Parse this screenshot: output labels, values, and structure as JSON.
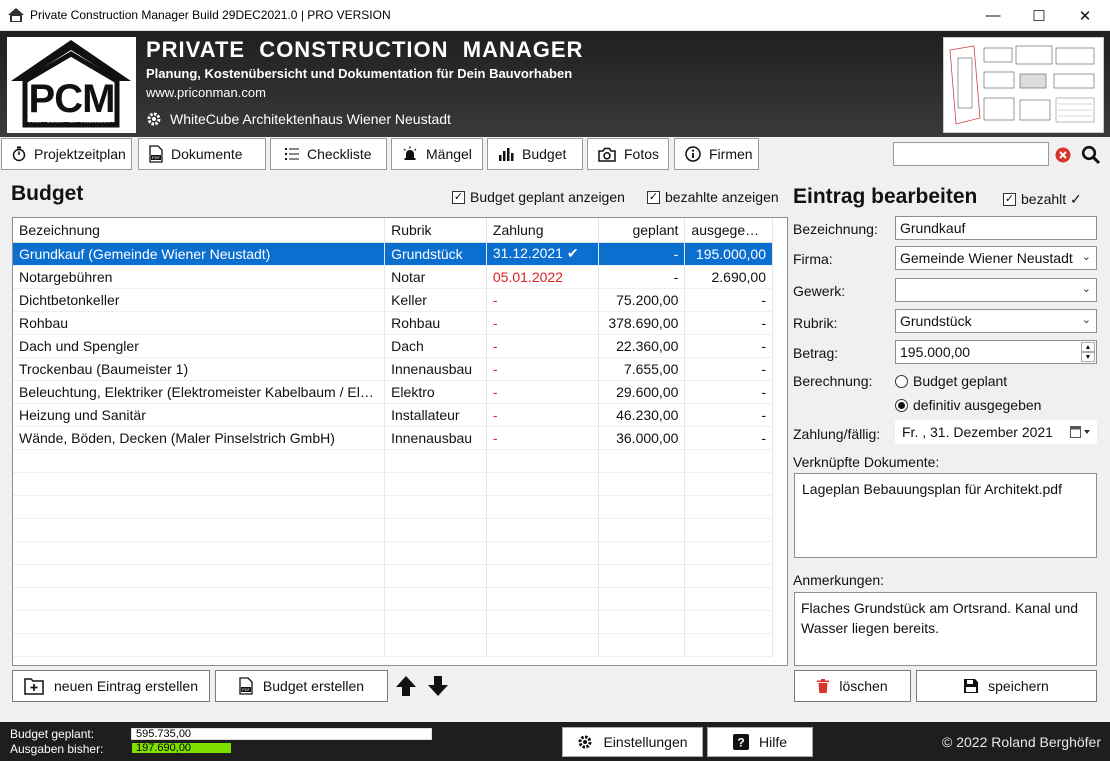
{
  "window": {
    "title": "Private Construction Manager Build 29DEC2021.0 | PRO VERSION",
    "minimize": "—",
    "maximize": "☐",
    "close": "✕"
  },
  "header": {
    "logo_text": "PCM",
    "logo_subtext": "PRIVATE CONSTRUCTION MANAGER",
    "title": "PRIVATE  CONSTRUCTION  MANAGER",
    "subtitle": "Planung, Kostenübersicht und Dokumentation für Dein Bauvorhaben",
    "website": "www.priconman.com",
    "project": "WhiteCube Architektenhaus Wiener Neustadt"
  },
  "toolbar": {
    "buttons": [
      {
        "label": "Projektzeitplan",
        "icon": "stopwatch-icon"
      },
      {
        "label": "Dokumente",
        "icon": "pdf-icon"
      },
      {
        "label": "Checkliste",
        "icon": "list-icon"
      },
      {
        "label": "Mängel",
        "icon": "alarm-icon"
      },
      {
        "label": "Budget",
        "icon": "bar-chart-icon"
      },
      {
        "label": "Fotos",
        "icon": "camera-icon"
      },
      {
        "label": "Firmen",
        "icon": "info-icon"
      }
    ],
    "search_value": ""
  },
  "budget": {
    "title": "Budget",
    "show_planned_label": "Budget geplant anzeigen",
    "show_planned": true,
    "show_paid_label": "bezahlte anzeigen",
    "show_paid": true,
    "columns": [
      "Bezeichnung",
      "Rubrik",
      "Zahlung",
      "geplant",
      "ausgegeben"
    ],
    "rows": [
      {
        "bezeichnung": "Grundkauf (Gemeinde Wiener Neustadt)",
        "rubrik": "Grundstück",
        "zahlung": "31.12.2021",
        "paid": true,
        "geplant": "-",
        "ausgegeben": "195.000,00",
        "selected": true
      },
      {
        "bezeichnung": "Notargebühren",
        "rubrik": "Notar",
        "zahlung": "05.01.2022",
        "paid": false,
        "geplant": "-",
        "ausgegeben": "2.690,00",
        "selected": false
      },
      {
        "bezeichnung": "Dichtbetonkeller",
        "rubrik": "Keller",
        "zahlung": "-",
        "paid": false,
        "geplant": "75.200,00",
        "ausgegeben": "-",
        "selected": false
      },
      {
        "bezeichnung": "Rohbau",
        "rubrik": "Rohbau",
        "zahlung": "-",
        "paid": false,
        "geplant": "378.690,00",
        "ausgegeben": "-",
        "selected": false
      },
      {
        "bezeichnung": "Dach und Spengler",
        "rubrik": "Dach",
        "zahlung": "-",
        "paid": false,
        "geplant": "22.360,00",
        "ausgegeben": "-",
        "selected": false
      },
      {
        "bezeichnung": "Trockenbau (Baumeister 1)",
        "rubrik": "Innenausbau",
        "zahlung": "-",
        "paid": false,
        "geplant": "7.655,00",
        "ausgegeben": "-",
        "selected": false
      },
      {
        "bezeichnung": "Beleuchtung, Elektriker (Elektromeister Kabelbaum / Ele...",
        "rubrik": "Elektro",
        "zahlung": "-",
        "paid": false,
        "geplant": "29.600,00",
        "ausgegeben": "-",
        "selected": false
      },
      {
        "bezeichnung": "Heizung und Sanitär",
        "rubrik": "Installateur",
        "zahlung": "-",
        "paid": false,
        "geplant": "46.230,00",
        "ausgegeben": "-",
        "selected": false
      },
      {
        "bezeichnung": "Wände, Böden, Decken (Maler Pinselstrich GmbH)",
        "rubrik": "Innenausbau",
        "zahlung": "-",
        "paid": false,
        "geplant": "36.000,00",
        "ausgegeben": "-",
        "selected": false
      }
    ],
    "new_entry_label": "neuen Eintrag erstellen",
    "create_budget_label": "Budget erstellen"
  },
  "edit": {
    "title": "Eintrag bearbeiten",
    "paid_label": "bezahlt ✓",
    "paid": true,
    "bezeichnung_label": "Bezeichnung:",
    "bezeichnung": "Grundkauf",
    "firma_label": "Firma:",
    "firma": "Gemeinde Wiener Neustadt",
    "gewerk_label": "Gewerk:",
    "gewerk": "",
    "rubrik_label": "Rubrik:",
    "rubrik": "Grundstück",
    "betrag_label": "Betrag:",
    "betrag": "195.000,00",
    "berechnung_label": "Berechnung:",
    "option_planned": "Budget geplant",
    "option_final": "definitiv ausgegeben",
    "selected_option": "final",
    "zahlung_label": "Zahlung/fällig:",
    "zahlung": "Fr. , 31. Dezember 2021",
    "docs_label": "Verknüpfte Dokumente:",
    "docs": [
      "Lageplan Bebauungsplan für Architekt.pdf"
    ],
    "notes_label": "Anmerkungen:",
    "notes": "Flaches Grundstück am Ortsrand. Kanal und Wasser liegen bereits.",
    "delete_label": "löschen",
    "save_label": "speichern"
  },
  "status": {
    "planned_label": "Budget  geplant:",
    "planned_value": "595.735,00",
    "spent_label": "Ausgaben bisher:",
    "spent_value": "197.690,00",
    "spent_fraction": 0.332,
    "spent_color": "#7fe000",
    "settings_label": "Einstellungen",
    "help_label": "Hilfe",
    "copyright": "© 2022 Roland Berghöfer"
  }
}
